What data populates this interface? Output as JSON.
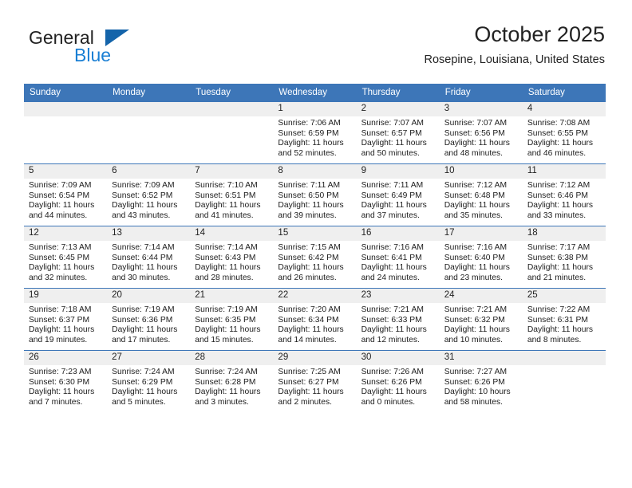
{
  "brand": {
    "name_top": "General",
    "name_bottom": "Blue",
    "triangle_color": "#1464aa",
    "blue_text_color": "#1a7fd4"
  },
  "header": {
    "title": "October 2025",
    "subtitle": "Rosepine, Louisiana, United States"
  },
  "theme": {
    "header_row_bg": "#3d76b8",
    "daynum_band_bg": "#efefef",
    "grid_line": "#3d76b8",
    "text": "#1c1c1c"
  },
  "weekdays": [
    "Sunday",
    "Monday",
    "Tuesday",
    "Wednesday",
    "Thursday",
    "Friday",
    "Saturday"
  ],
  "labels": {
    "sunrise_prefix": "Sunrise:",
    "sunset_prefix": "Sunset:",
    "daylight_prefix": "Daylight:"
  },
  "weeks": [
    [
      {
        "day": "",
        "empty": true
      },
      {
        "day": "",
        "empty": true
      },
      {
        "day": "",
        "empty": true
      },
      {
        "day": "1",
        "sunrise": "Sunrise: 7:06 AM",
        "sunset": "Sunset: 6:59 PM",
        "daylight_line1": "Daylight: 11 hours",
        "daylight_line2": "and 52 minutes."
      },
      {
        "day": "2",
        "sunrise": "Sunrise: 7:07 AM",
        "sunset": "Sunset: 6:57 PM",
        "daylight_line1": "Daylight: 11 hours",
        "daylight_line2": "and 50 minutes."
      },
      {
        "day": "3",
        "sunrise": "Sunrise: 7:07 AM",
        "sunset": "Sunset: 6:56 PM",
        "daylight_line1": "Daylight: 11 hours",
        "daylight_line2": "and 48 minutes."
      },
      {
        "day": "4",
        "sunrise": "Sunrise: 7:08 AM",
        "sunset": "Sunset: 6:55 PM",
        "daylight_line1": "Daylight: 11 hours",
        "daylight_line2": "and 46 minutes."
      }
    ],
    [
      {
        "day": "5",
        "sunrise": "Sunrise: 7:09 AM",
        "sunset": "Sunset: 6:54 PM",
        "daylight_line1": "Daylight: 11 hours",
        "daylight_line2": "and 44 minutes."
      },
      {
        "day": "6",
        "sunrise": "Sunrise: 7:09 AM",
        "sunset": "Sunset: 6:52 PM",
        "daylight_line1": "Daylight: 11 hours",
        "daylight_line2": "and 43 minutes."
      },
      {
        "day": "7",
        "sunrise": "Sunrise: 7:10 AM",
        "sunset": "Sunset: 6:51 PM",
        "daylight_line1": "Daylight: 11 hours",
        "daylight_line2": "and 41 minutes."
      },
      {
        "day": "8",
        "sunrise": "Sunrise: 7:11 AM",
        "sunset": "Sunset: 6:50 PM",
        "daylight_line1": "Daylight: 11 hours",
        "daylight_line2": "and 39 minutes."
      },
      {
        "day": "9",
        "sunrise": "Sunrise: 7:11 AM",
        "sunset": "Sunset: 6:49 PM",
        "daylight_line1": "Daylight: 11 hours",
        "daylight_line2": "and 37 minutes."
      },
      {
        "day": "10",
        "sunrise": "Sunrise: 7:12 AM",
        "sunset": "Sunset: 6:48 PM",
        "daylight_line1": "Daylight: 11 hours",
        "daylight_line2": "and 35 minutes."
      },
      {
        "day": "11",
        "sunrise": "Sunrise: 7:12 AM",
        "sunset": "Sunset: 6:46 PM",
        "daylight_line1": "Daylight: 11 hours",
        "daylight_line2": "and 33 minutes."
      }
    ],
    [
      {
        "day": "12",
        "sunrise": "Sunrise: 7:13 AM",
        "sunset": "Sunset: 6:45 PM",
        "daylight_line1": "Daylight: 11 hours",
        "daylight_line2": "and 32 minutes."
      },
      {
        "day": "13",
        "sunrise": "Sunrise: 7:14 AM",
        "sunset": "Sunset: 6:44 PM",
        "daylight_line1": "Daylight: 11 hours",
        "daylight_line2": "and 30 minutes."
      },
      {
        "day": "14",
        "sunrise": "Sunrise: 7:14 AM",
        "sunset": "Sunset: 6:43 PM",
        "daylight_line1": "Daylight: 11 hours",
        "daylight_line2": "and 28 minutes."
      },
      {
        "day": "15",
        "sunrise": "Sunrise: 7:15 AM",
        "sunset": "Sunset: 6:42 PM",
        "daylight_line1": "Daylight: 11 hours",
        "daylight_line2": "and 26 minutes."
      },
      {
        "day": "16",
        "sunrise": "Sunrise: 7:16 AM",
        "sunset": "Sunset: 6:41 PM",
        "daylight_line1": "Daylight: 11 hours",
        "daylight_line2": "and 24 minutes."
      },
      {
        "day": "17",
        "sunrise": "Sunrise: 7:16 AM",
        "sunset": "Sunset: 6:40 PM",
        "daylight_line1": "Daylight: 11 hours",
        "daylight_line2": "and 23 minutes."
      },
      {
        "day": "18",
        "sunrise": "Sunrise: 7:17 AM",
        "sunset": "Sunset: 6:38 PM",
        "daylight_line1": "Daylight: 11 hours",
        "daylight_line2": "and 21 minutes."
      }
    ],
    [
      {
        "day": "19",
        "sunrise": "Sunrise: 7:18 AM",
        "sunset": "Sunset: 6:37 PM",
        "daylight_line1": "Daylight: 11 hours",
        "daylight_line2": "and 19 minutes."
      },
      {
        "day": "20",
        "sunrise": "Sunrise: 7:19 AM",
        "sunset": "Sunset: 6:36 PM",
        "daylight_line1": "Daylight: 11 hours",
        "daylight_line2": "and 17 minutes."
      },
      {
        "day": "21",
        "sunrise": "Sunrise: 7:19 AM",
        "sunset": "Sunset: 6:35 PM",
        "daylight_line1": "Daylight: 11 hours",
        "daylight_line2": "and 15 minutes."
      },
      {
        "day": "22",
        "sunrise": "Sunrise: 7:20 AM",
        "sunset": "Sunset: 6:34 PM",
        "daylight_line1": "Daylight: 11 hours",
        "daylight_line2": "and 14 minutes."
      },
      {
        "day": "23",
        "sunrise": "Sunrise: 7:21 AM",
        "sunset": "Sunset: 6:33 PM",
        "daylight_line1": "Daylight: 11 hours",
        "daylight_line2": "and 12 minutes."
      },
      {
        "day": "24",
        "sunrise": "Sunrise: 7:21 AM",
        "sunset": "Sunset: 6:32 PM",
        "daylight_line1": "Daylight: 11 hours",
        "daylight_line2": "and 10 minutes."
      },
      {
        "day": "25",
        "sunrise": "Sunrise: 7:22 AM",
        "sunset": "Sunset: 6:31 PM",
        "daylight_line1": "Daylight: 11 hours",
        "daylight_line2": "and 8 minutes."
      }
    ],
    [
      {
        "day": "26",
        "sunrise": "Sunrise: 7:23 AM",
        "sunset": "Sunset: 6:30 PM",
        "daylight_line1": "Daylight: 11 hours",
        "daylight_line2": "and 7 minutes."
      },
      {
        "day": "27",
        "sunrise": "Sunrise: 7:24 AM",
        "sunset": "Sunset: 6:29 PM",
        "daylight_line1": "Daylight: 11 hours",
        "daylight_line2": "and 5 minutes."
      },
      {
        "day": "28",
        "sunrise": "Sunrise: 7:24 AM",
        "sunset": "Sunset: 6:28 PM",
        "daylight_line1": "Daylight: 11 hours",
        "daylight_line2": "and 3 minutes."
      },
      {
        "day": "29",
        "sunrise": "Sunrise: 7:25 AM",
        "sunset": "Sunset: 6:27 PM",
        "daylight_line1": "Daylight: 11 hours",
        "daylight_line2": "and 2 minutes."
      },
      {
        "day": "30",
        "sunrise": "Sunrise: 7:26 AM",
        "sunset": "Sunset: 6:26 PM",
        "daylight_line1": "Daylight: 11 hours",
        "daylight_line2": "and 0 minutes."
      },
      {
        "day": "31",
        "sunrise": "Sunrise: 7:27 AM",
        "sunset": "Sunset: 6:26 PM",
        "daylight_line1": "Daylight: 10 hours",
        "daylight_line2": "and 58 minutes."
      },
      {
        "day": "",
        "empty": true
      }
    ]
  ]
}
